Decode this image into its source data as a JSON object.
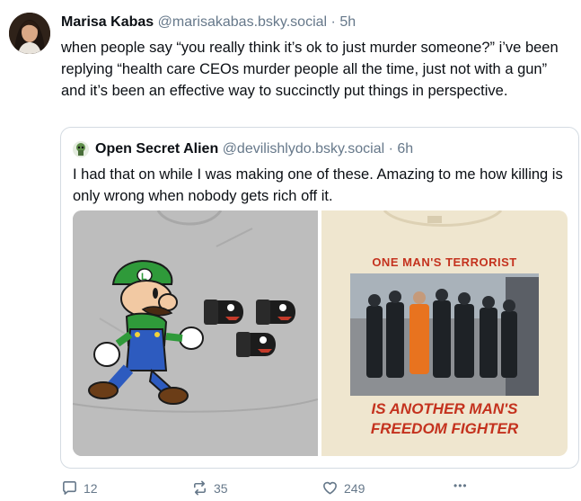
{
  "post": {
    "author_name": "Marisa Kabas",
    "handle": "@marisakabas.bsky.social",
    "separator": "·",
    "time": "5h",
    "text": "when people say “you really think it’s ok to just murder someone?” i’ve been replying “health care CEOs murder people all the time, just not with a gun” and it’s been an effective way to succinctly put things in perspective."
  },
  "quote": {
    "author_name": "Open Secret Alien",
    "handle": "@devilishlydo.bsky.social",
    "separator": "·",
    "time": "6h",
    "text": "I had that on while I was making one of these. Amazing to me how killing is only wrong when nobody gets rich off it.",
    "image_right": {
      "top_caption": "ONE MAN'S TERRORIST",
      "bottom_line1": "IS ANOTHER MAN'S",
      "bottom_line2": "FREEDOM FIGHTER"
    }
  },
  "actions": {
    "reply_count": "12",
    "repost_count": "35",
    "like_count": "249",
    "more_label": "•••"
  },
  "colors": {
    "text": "#0b0f14",
    "muted": "#66788a",
    "border": "#d4dbe2",
    "shirt_gray": "#b9b9b9",
    "shirt_cream": "#f3ebd6",
    "print_red": "#c4321e"
  },
  "icons": [
    "reply-icon",
    "repost-icon",
    "heart-icon",
    "more-icon"
  ]
}
